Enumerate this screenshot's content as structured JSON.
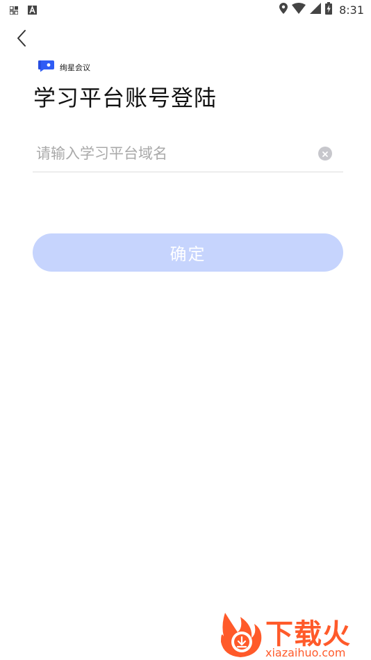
{
  "status_bar": {
    "time": "8:31",
    "left_icons": [
      "grid-notification-icon",
      "text-a-notification-icon"
    ],
    "right_icons": [
      "location-icon",
      "wifi-icon",
      "signal-icon",
      "battery-charging-icon"
    ]
  },
  "header": {
    "back_icon": "chevron-left-icon"
  },
  "brand": {
    "name": "绚星会议",
    "accent_color": "#2f5cf5"
  },
  "page": {
    "title": "学习平台账号登陆"
  },
  "form": {
    "domain_input": {
      "value": "",
      "placeholder": "请输入学习平台域名"
    },
    "clear_icon": "clear-circle-icon",
    "confirm_label": "确定",
    "confirm_color": "#c6d4fd"
  },
  "watermark": {
    "text": "下载火",
    "url": "xiazaihuo.com",
    "color": "#ff5a2a"
  }
}
